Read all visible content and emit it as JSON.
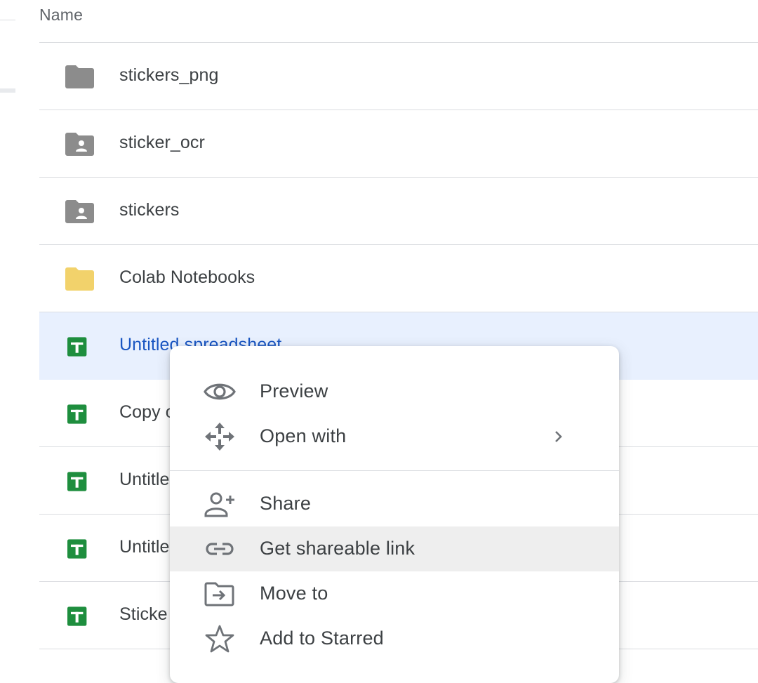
{
  "header": {
    "name_column": "Name"
  },
  "files": [
    {
      "name": "stickers_png",
      "icon": "folder-icon",
      "color": "#8c8c8c",
      "selected": false
    },
    {
      "name": "sticker_ocr",
      "icon": "shared-folder-icon",
      "color": "#8c8c8c",
      "selected": false
    },
    {
      "name": "stickers",
      "icon": "shared-folder-icon",
      "color": "#8c8c8c",
      "selected": false
    },
    {
      "name": "Colab Notebooks",
      "icon": "folder-icon",
      "color": "#f2d26b",
      "selected": false
    },
    {
      "name": "Untitled spreadsheet",
      "icon": "sheets-icon",
      "color": "#1e8e3e",
      "selected": true
    },
    {
      "name": "Copy o",
      "icon": "sheets-icon",
      "color": "#1e8e3e",
      "selected": false
    },
    {
      "name": "Untitle",
      "icon": "sheets-icon",
      "color": "#1e8e3e",
      "selected": false
    },
    {
      "name": "Untitle",
      "icon": "sheets-icon",
      "color": "#1e8e3e",
      "selected": false
    },
    {
      "name": "Sticke",
      "icon": "sheets-icon",
      "color": "#1e8e3e",
      "selected": false
    }
  ],
  "context_menu": {
    "items": [
      {
        "label": "Preview",
        "icon": "eye-icon"
      },
      {
        "label": "Open with",
        "icon": "move-arrows-icon",
        "submenu": true
      },
      {
        "label": "Share",
        "icon": "add-person-icon"
      },
      {
        "label": "Get shareable link",
        "icon": "link-icon",
        "highlighted": true
      },
      {
        "label": "Move to",
        "icon": "move-to-folder-icon"
      },
      {
        "label": "Add to Starred",
        "icon": "star-outline-icon"
      }
    ]
  },
  "colors": {
    "selection_bg": "#e8f0fe",
    "selected_text": "#1a56c2",
    "menu_highlight": "#eeeeee",
    "divider": "#dadce0"
  }
}
